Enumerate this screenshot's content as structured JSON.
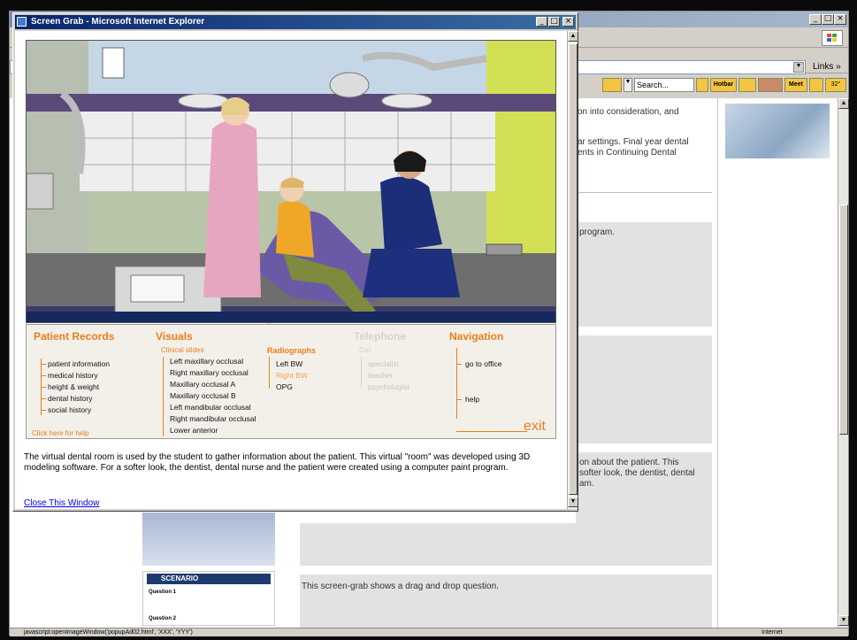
{
  "background_window": {
    "links_label": "Links",
    "links_chevron": "»",
    "search_label": "Search...",
    "hotbar_label": "Hotbar",
    "meet_label": "Meet",
    "temp_label": "32°",
    "status_url": "javascript:openImageWindow('popupAd02.html', 'XXX', 'YYY')",
    "status_zone": "Internet",
    "content_texts": [
      "on into consideration, and",
      "ar settings. Final year dental",
      "ents in Continuing Dental",
      "program.",
      "on about the patient. This",
      "softer look, the dentist, dental",
      "am.",
      "This screen-grab shows a drag and drop question."
    ],
    "thumb_title": "SCENARIO",
    "thumb_q1": "Question 1",
    "thumb_q2": "Question 2",
    "colors": {
      "title_inactive": "#8da0bd",
      "gray_block": "#e2e2e2"
    }
  },
  "popup": {
    "title": "Screen Grab - Microsoft Internet Explorer",
    "colors": {
      "title_active": "#0a246a",
      "menu_accent": "#e87f1c"
    },
    "menu": {
      "patient_records": {
        "heading": "Patient Records",
        "items": [
          "patient information",
          "medical history",
          "height & weight",
          "dental history",
          "social history"
        ],
        "help": "Click here for help"
      },
      "visuals": {
        "heading": "Visuals",
        "clinical_slides": {
          "heading": "Clinical slides",
          "items": [
            "Left maxillary occlusal",
            "Right maxillary occlusal",
            "Maxillary occlusal A",
            "Maxillary occlusal B",
            "Left mandibular occlusal",
            "Right mandibular occlusal",
            "Lower anterior"
          ]
        },
        "radiographs": {
          "heading": "Radiographs",
          "items": [
            "Left BW",
            "Right BW",
            "OPG"
          ]
        }
      },
      "telephone": {
        "heading": "Telephone",
        "sub": "Call",
        "items": [
          "specialist",
          "teacher",
          "psychologist"
        ]
      },
      "navigation": {
        "heading": "Navigation",
        "items": [
          "go to office",
          "help"
        ],
        "exit": "exit"
      }
    },
    "description": "The virtual dental room is used by the student to gather information about the patient. This virtual \"room\" was developed using 3D modeling software. For a softer look, the dentist, dental nurse and the patient were created using a computer paint program.",
    "close_link": "Close This Window"
  }
}
